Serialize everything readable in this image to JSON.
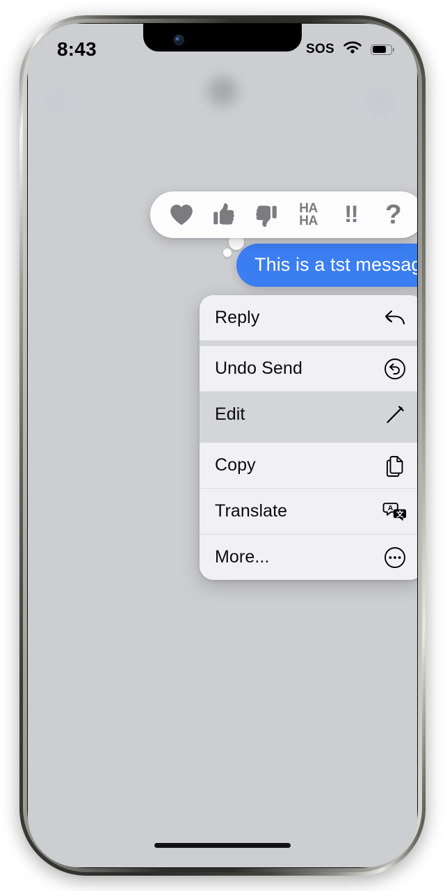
{
  "status_bar": {
    "time": "8:43",
    "sos_label": "SOS",
    "wifi_icon": "wifi-icon",
    "battery_icon": "battery-icon",
    "battery_level_pct": 66
  },
  "nav_bar": {
    "back_icon": "chevron-left-icon",
    "contact_name": "",
    "avatar_icon": "contact-avatar",
    "right_icon": "facetime-video-icon",
    "blurred": true
  },
  "reaction_bar": {
    "reactions": [
      {
        "id": "heart",
        "icon": "heart-icon",
        "label": ""
      },
      {
        "id": "thumbsup",
        "icon": "thumbs-up-icon",
        "label": ""
      },
      {
        "id": "thumbsdown",
        "icon": "thumbs-down-icon",
        "label": ""
      },
      {
        "id": "haha",
        "icon": "haha-icon",
        "label": "HA HA",
        "line1": "HA",
        "line2": "HA"
      },
      {
        "id": "exclaim",
        "icon": "double-exclamation-icon",
        "label": "!!"
      },
      {
        "id": "question",
        "icon": "question-mark-icon",
        "label": "?"
      }
    ]
  },
  "message": {
    "text": "This is a tst message",
    "sender": "outgoing",
    "bubble_color": "#3b7ef2",
    "text_color": "#ffffff"
  },
  "context_menu": {
    "items": [
      {
        "label": "Reply",
        "icon": "reply-arrow-icon",
        "pressed": false
      },
      {
        "label": "Undo Send",
        "icon": "undo-circle-icon",
        "pressed": false
      },
      {
        "label": "Edit",
        "icon": "pencil-icon",
        "pressed": true
      },
      {
        "label": "Copy",
        "icon": "copy-documents-icon",
        "pressed": false
      },
      {
        "label": "Translate",
        "icon": "translate-icon",
        "pressed": false
      },
      {
        "label": "More...",
        "icon": "ellipsis-circle-icon",
        "pressed": false
      }
    ]
  },
  "device": {
    "home_indicator": "home-indicator",
    "buttons": [
      "silent-switch",
      "volume-up",
      "volume-down",
      "power-button"
    ],
    "screen_background": "#cdced2"
  }
}
